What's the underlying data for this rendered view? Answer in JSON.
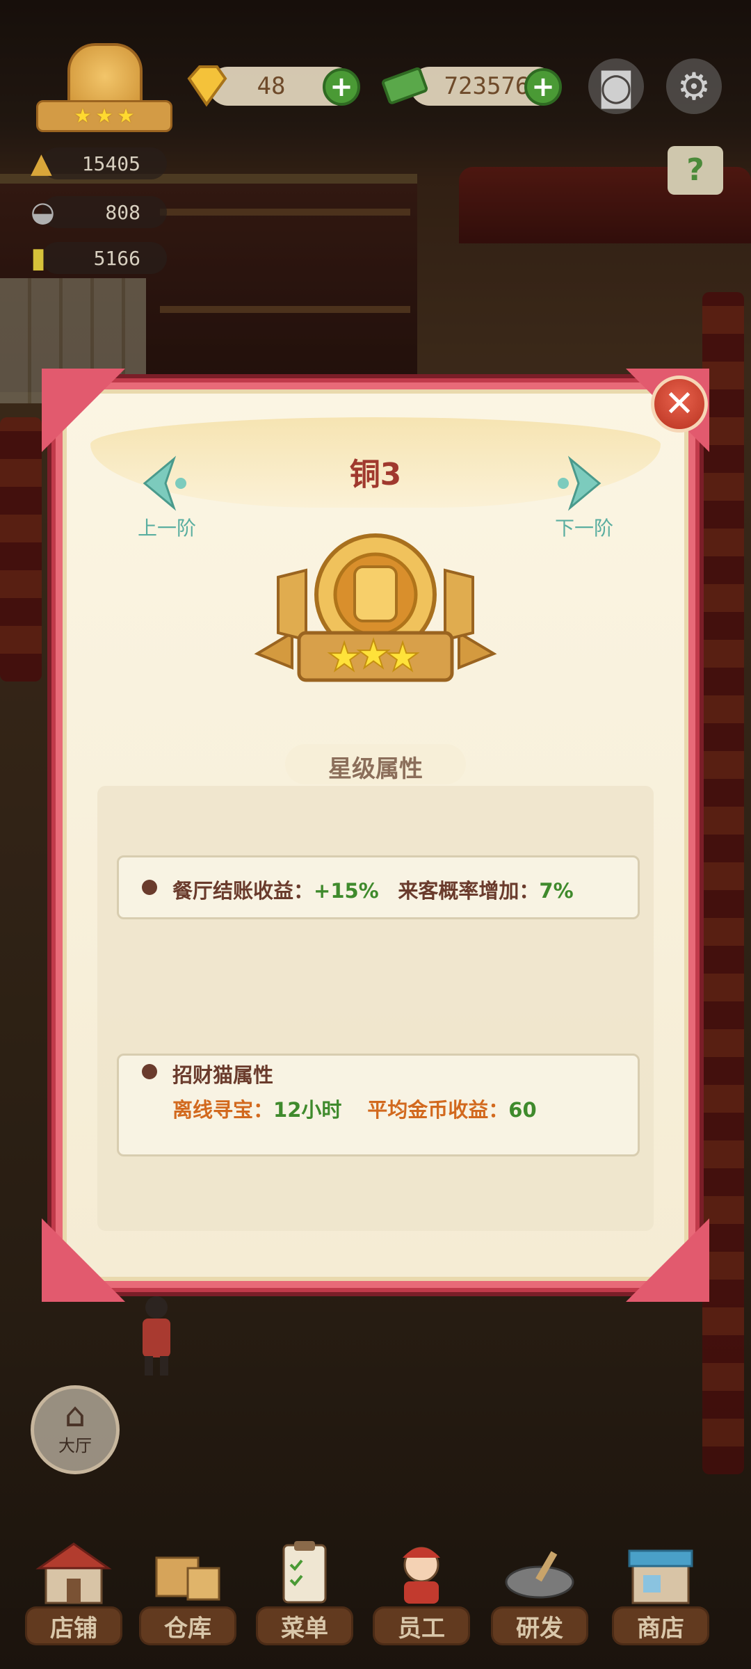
{
  "hud": {
    "level_stars": 3,
    "gems": "48",
    "cash": "723576",
    "stats": [
      "15405",
      "808",
      "5166"
    ],
    "icons": [
      "gem-icon",
      "cash-icon",
      "camera-icon",
      "gear-icon",
      "help-book-icon"
    ]
  },
  "modal": {
    "title": "铜3",
    "prev_label": "上一阶",
    "next_label": "下一阶",
    "badge_stars": 3,
    "section_title": "星级属性",
    "attr1": {
      "label1": "餐厅结账收益：",
      "value1": "+15%",
      "label2": "来客概率增加：",
      "value2": "7%"
    },
    "attr2": {
      "heading": "招财猫属性",
      "label1": "离线寻宝：",
      "value1": "12小时",
      "label2": "平均金币收益：",
      "value2": "60"
    }
  },
  "hall_button": "大厅",
  "bottom_nav": [
    {
      "label": "店铺",
      "icon": "shop-building-icon"
    },
    {
      "label": "仓库",
      "icon": "warehouse-boxes-icon"
    },
    {
      "label": "菜单",
      "icon": "menu-clipboard-icon"
    },
    {
      "label": "员工",
      "icon": "staff-chef-icon"
    },
    {
      "label": "研发",
      "icon": "research-wok-icon"
    },
    {
      "label": "商店",
      "icon": "store-icon"
    }
  ],
  "colors": {
    "frame": "#c03a4a",
    "title": "#a0392e",
    "value_green": "#3f8a2c",
    "label_orange": "#d2691e",
    "nav_teal": "#5aaea0"
  }
}
